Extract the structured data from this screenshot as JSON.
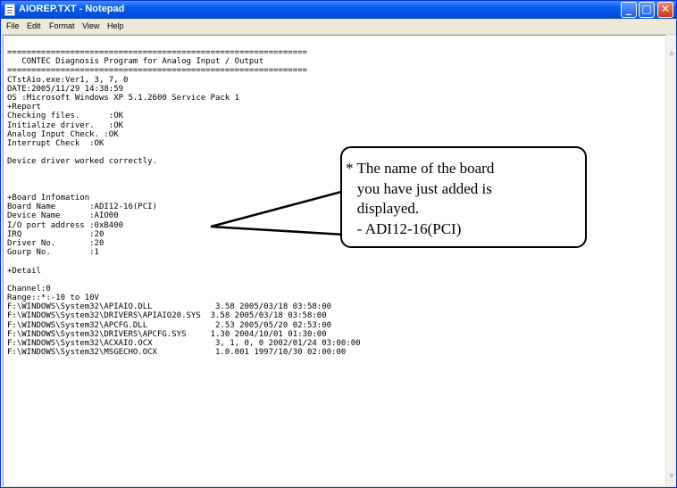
{
  "window": {
    "title": "AIOREP.TXT - Notepad",
    "controls": {
      "minimize": "_",
      "maximize": "□",
      "close": "✕"
    }
  },
  "menu": {
    "items": [
      "File",
      "Edit",
      "Format",
      "View",
      "Help"
    ]
  },
  "document": {
    "lines": [
      "==============================================================",
      "   CONTEC Diagnosis Program for Analog Input / Output",
      "==============================================================",
      "CTstAio.exe:Ver1, 3, 7, 0",
      "DATE:2005/11/29 14:38:59",
      "OS :Microsoft Windows XP 5.1.2600 Service Pack 1",
      "+Report",
      "Checking files.      :OK",
      "Initialize driver.   :OK",
      "Analog Input Check. :OK",
      "Interrupt Check  :OK",
      "",
      "Device driver worked correctly.",
      "",
      "",
      "",
      "+Board Infomation",
      "Board Name       :ADI12-16(PCI)",
      "Device Name      :AIO00",
      "I/O port address :0xB400",
      "IRQ              :20",
      "Driver No.       :20",
      "Gourp No.        :1",
      "",
      "+Detail",
      "",
      "Channel:0",
      "Range::*:-10 to 10V",
      "F:\\WINDOWS\\System32\\APIAIO.DLL             3.58 2005/03/18 03:58:00",
      "F:\\WINDOWS\\System32\\DRIVERS\\APIAIO20.SYS  3.58 2005/03/18 03:58:00",
      "F:\\WINDOWS\\System32\\APCFG.DLL              2.53 2005/05/20 02:53:00",
      "F:\\WINDOWS\\System32\\DRIVERS\\APCFG.SYS     1.30 2004/10/01 01:30:00",
      "F:\\WINDOWS\\System32\\ACXAIO.OCX             3, 1, 0, 0 2002/01/24 03:00:00",
      "F:\\WINDOWS\\System32\\MSGECHO.OCX            1.0.001 1997/10/30 02:00:00"
    ]
  },
  "callout": {
    "lines": [
      "* The name of the board",
      "   you have just added is",
      "   displayed.",
      "   - ADI12-16(PCI)"
    ]
  },
  "icons": {
    "app": "notepad-icon",
    "scroll_up": "scroll-up-arrow-icon",
    "scroll_down": "scroll-down-arrow-icon"
  },
  "colors": {
    "titlebar": "#0054e3",
    "close_button": "#c8391a",
    "window_face": "#ece9d8"
  }
}
